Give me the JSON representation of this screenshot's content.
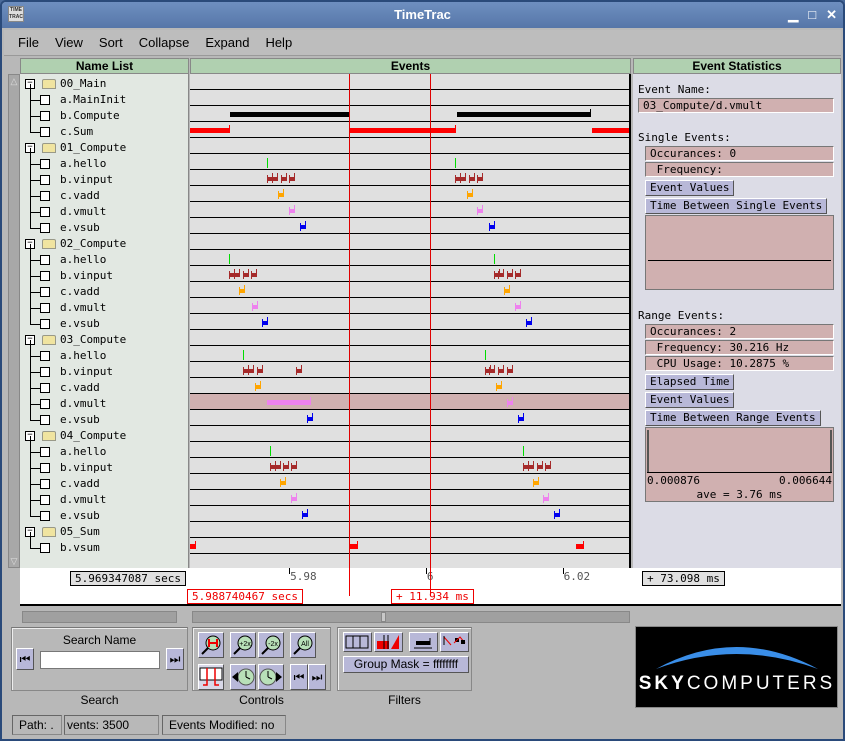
{
  "window": {
    "title": "TimeTrac",
    "app_icon": "TIME TRAC",
    "controls": [
      "minimize-icon",
      "maximize-icon",
      "close-icon"
    ]
  },
  "menu": [
    "File",
    "View",
    "Sort",
    "Collapse",
    "Expand",
    "Help"
  ],
  "headers": {
    "names": "Name List",
    "events": "Events",
    "stats": "Event Statistics"
  },
  "tree": [
    {
      "label": "00_Main",
      "type": "group"
    },
    {
      "label": "a.MainInit",
      "type": "item"
    },
    {
      "label": "b.Compute",
      "type": "item"
    },
    {
      "label": "c.Sum",
      "type": "item"
    },
    {
      "label": "01_Compute",
      "type": "group"
    },
    {
      "label": "a.hello",
      "type": "item"
    },
    {
      "label": "b.vinput",
      "type": "item"
    },
    {
      "label": "c.vadd",
      "type": "item"
    },
    {
      "label": "d.vmult",
      "type": "item"
    },
    {
      "label": "e.vsub",
      "type": "item"
    },
    {
      "label": "02_Compute",
      "type": "group"
    },
    {
      "label": "a.hello",
      "type": "item"
    },
    {
      "label": "b.vinput",
      "type": "item"
    },
    {
      "label": "c.vadd",
      "type": "item"
    },
    {
      "label": "d.vmult",
      "type": "item"
    },
    {
      "label": "e.vsub",
      "type": "item"
    },
    {
      "label": "03_Compute",
      "type": "group"
    },
    {
      "label": "a.hello",
      "type": "item"
    },
    {
      "label": "b.vinput",
      "type": "item"
    },
    {
      "label": "c.vadd",
      "type": "item"
    },
    {
      "label": "d.vmult",
      "type": "item",
      "selected": true
    },
    {
      "label": "e.vsub",
      "type": "item"
    },
    {
      "label": "04_Compute",
      "type": "group"
    },
    {
      "label": "a.hello",
      "type": "item"
    },
    {
      "label": "b.vinput",
      "type": "item"
    },
    {
      "label": "c.vadd",
      "type": "item"
    },
    {
      "label": "d.vmult",
      "type": "item"
    },
    {
      "label": "e.vsub",
      "type": "item"
    },
    {
      "label": "05_Sum",
      "type": "group"
    },
    {
      "label": "b.vsum",
      "type": "item"
    }
  ],
  "event_colors": {
    "range_black": "#000000",
    "range_red": "#ff0000",
    "hello": "#00dd00",
    "vinput": "#a52a2a",
    "vadd": "#ffa500",
    "vmult": "#ee82ee",
    "vsub": "#0000ee",
    "cursor": "#e00000",
    "selected_row": "#d0b0b0"
  },
  "events": [
    {
      "row": 2,
      "kind": "range",
      "color": "range_black",
      "spans": [
        [
          5.9713,
          5.9889
        ],
        [
          6.0045,
          6.0242
        ]
      ]
    },
    {
      "row": 3,
      "kind": "range",
      "color": "range_red",
      "spans": [
        [
          5.9655,
          5.9713
        ],
        [
          5.9887,
          6.0044
        ],
        [
          6.0243,
          6.03
        ]
      ]
    },
    {
      "row": 5,
      "kind": "tick",
      "color": "hello",
      "t": [
        5.9768,
        6.0043
      ]
    },
    {
      "row": 6,
      "kind": "flag",
      "color": "vinput",
      "t": [
        5.9768,
        5.9775,
        5.9788,
        5.98,
        6.0043,
        6.005,
        6.0063,
        6.0075
      ]
    },
    {
      "row": 7,
      "kind": "flag",
      "color": "vadd",
      "t": [
        5.9783,
        6.006
      ]
    },
    {
      "row": 8,
      "kind": "flag",
      "color": "vmult",
      "t": [
        5.98,
        6.0075
      ]
    },
    {
      "row": 9,
      "kind": "flag",
      "color": "vsub",
      "t": [
        5.9816,
        6.0092
      ]
    },
    {
      "row": 11,
      "kind": "tick",
      "color": "hello",
      "t": [
        5.9712,
        6.0099
      ]
    },
    {
      "row": 12,
      "kind": "flag",
      "color": "vinput",
      "t": [
        5.9712,
        5.9719,
        5.9732,
        5.9744,
        6.0099,
        6.0106,
        6.0118,
        6.013
      ]
    },
    {
      "row": 13,
      "kind": "flag",
      "color": "vadd",
      "t": [
        5.9727,
        6.0114
      ]
    },
    {
      "row": 14,
      "kind": "flag",
      "color": "vmult",
      "t": [
        5.9745,
        6.0131
      ]
    },
    {
      "row": 15,
      "kind": "flag",
      "color": "vsub",
      "t": [
        5.976,
        6.0146
      ]
    },
    {
      "row": 17,
      "kind": "tick",
      "color": "hello",
      "t": [
        5.9733,
        6.0086
      ]
    },
    {
      "row": 18,
      "kind": "flag",
      "color": "vinput",
      "t": [
        5.9733,
        5.974,
        5.9753,
        5.981,
        6.0086,
        6.0093,
        6.0106,
        6.0118
      ]
    },
    {
      "row": 19,
      "kind": "flag",
      "color": "vadd",
      "t": [
        5.975,
        6.0102
      ]
    },
    {
      "row": 20,
      "kind": "range",
      "color": "vmult",
      "spans": [
        [
          5.9767,
          5.9832
        ]
      ]
    },
    {
      "row": 20,
      "kind": "flag",
      "color": "vmult",
      "t": [
        6.0118
      ]
    },
    {
      "row": 21,
      "kind": "flag",
      "color": "vsub",
      "t": [
        5.9826,
        6.0134
      ]
    },
    {
      "row": 23,
      "kind": "tick",
      "color": "hello",
      "t": [
        5.9772,
        6.0142
      ]
    },
    {
      "row": 24,
      "kind": "flag",
      "color": "vinput",
      "t": [
        5.9772,
        5.9779,
        5.9791,
        5.9803,
        6.0142,
        6.0149,
        6.0162,
        6.0174
      ]
    },
    {
      "row": 25,
      "kind": "flag",
      "color": "vadd",
      "t": [
        5.9787,
        6.0156
      ]
    },
    {
      "row": 26,
      "kind": "flag",
      "color": "vmult",
      "t": [
        5.9803,
        6.0171
      ]
    },
    {
      "row": 27,
      "kind": "flag",
      "color": "vsub",
      "t": [
        5.9819,
        6.0187
      ]
    },
    {
      "row": 29,
      "kind": "range",
      "color": "range_red",
      "spans": [
        [
          5.9655,
          5.9664
        ],
        [
          5.9889,
          5.99
        ],
        [
          6.022,
          6.0231
        ]
      ]
    }
  ],
  "timeline": {
    "start": 5.9655,
    "end": 6.03,
    "left_label": "5.969347087 secs",
    "cursor1_label": "5.988740467 secs",
    "cursor2_label": "+ 11.934 ms",
    "right_label": "+ 73.098 ms",
    "cursor1_t": 5.98874,
    "cursor2_t": 6.00067,
    "ticks": [
      {
        "t": 5.98,
        "label": "5.98"
      },
      {
        "t": 6.0,
        "label": "6"
      },
      {
        "t": 6.02,
        "label": "6.02"
      }
    ]
  },
  "stats": {
    "event_name_label": "Event Name:",
    "event_name": "03_Compute/d.vmult",
    "single_label": "Single Events:",
    "single_occ": "Occurances: 0",
    "single_freq": " Frequency:",
    "single_btn_values": "Event Values",
    "single_btn_between": "Time Between Single Events",
    "range_label": "Range Events:",
    "range_occ": "Occurances: 2",
    "range_freq": " Frequency: 30.216 Hz",
    "range_cpu": " CPU Usage: 10.2875 %",
    "range_btn_elapsed": "Elapsed Time",
    "range_btn_values": "Event Values",
    "range_btn_between": "Time Between Range Events",
    "hist_min": "0.000876",
    "hist_max": "0.006644",
    "hist_ave": "ave = 3.76 ms"
  },
  "search": {
    "title": "Search Name",
    "value": "",
    "label": "Search"
  },
  "controls": {
    "label": "Controls",
    "buttons": [
      "zoom-to-range",
      "zoom-in-2x",
      "zoom-out-2x",
      "zoom-all",
      "cursor-mode",
      "time-back",
      "time-forward",
      "jump-first",
      "jump-last"
    ]
  },
  "filters": {
    "label": "Filters",
    "group_mask": "Group Mask = ffffffff"
  },
  "logo": {
    "bold": "SKY",
    "rest": "COMPUTERS"
  },
  "status": {
    "path": "Path: .",
    "events": "vents: 3500",
    "modified": "Events Modified: no"
  }
}
